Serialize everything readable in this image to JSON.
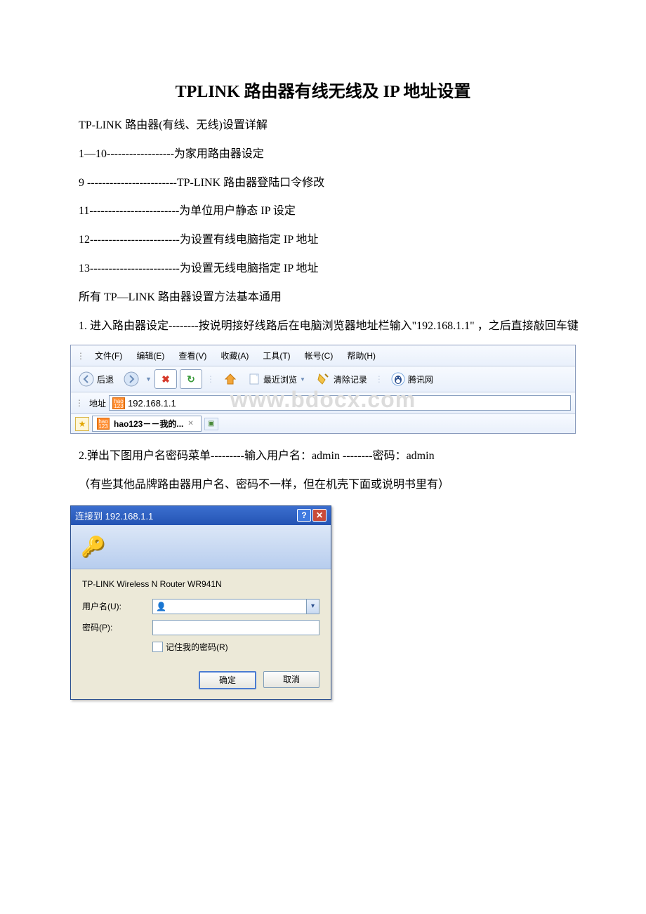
{
  "title": "TPLINK 路由器有线无线及 IP 地址设置",
  "lines": {
    "l1": "TP-LINK 路由器(有线、无线)设置详解",
    "l2": "1—10------------------为家用路由器设定",
    "l3": "9 ------------------------TP-LINK 路由器登陆口令修改",
    "l4": "11------------------------为单位用户静态 IP 设定",
    "l5": "12------------------------为设置有线电脑指定 IP 地址",
    "l6": "13------------------------为设置无线电脑指定 IP 地址",
    "l7": "所有 TP—LINK 路由器设置方法基本通用",
    "l8": "1. 进入路由器设定--------按说明接好线路后在电脑浏览器地址栏输入\"192.168.1.1\" ，之后直接敲回车键",
    "l9": "2.弹出下图用户名密码菜单---------输入用户名：admin --------密码：admin",
    "l10": "（有些其他品牌路由器用户名、密码不一样，但在机壳下面或说明书里有）"
  },
  "browser": {
    "menu": {
      "file": "文件(F)",
      "edit": "编辑(E)",
      "view": "查看(V)",
      "fav": "收藏(A)",
      "tool": "工具(T)",
      "acct": "帐号(C)",
      "help": "帮助(H)"
    },
    "back": "后退",
    "recent": "最近浏览",
    "clear": "清除记录",
    "tencent": "腾讯网",
    "addr_label": "地址",
    "addr_value": "192.168.1.1",
    "tab_title": "hao123－－我的...",
    "hao_badge": "hao\n123",
    "watermark": "www.bdocx.com"
  },
  "dialog": {
    "title": "连接到 192.168.1.1",
    "server": "TP-LINK Wireless N Router WR941N",
    "user_label": "用户名(U):",
    "pass_label": "密码(P):",
    "remember": "记住我的密码(R)",
    "ok": "确定",
    "cancel": "取消",
    "help_btn": "?",
    "close_btn": "✕"
  }
}
